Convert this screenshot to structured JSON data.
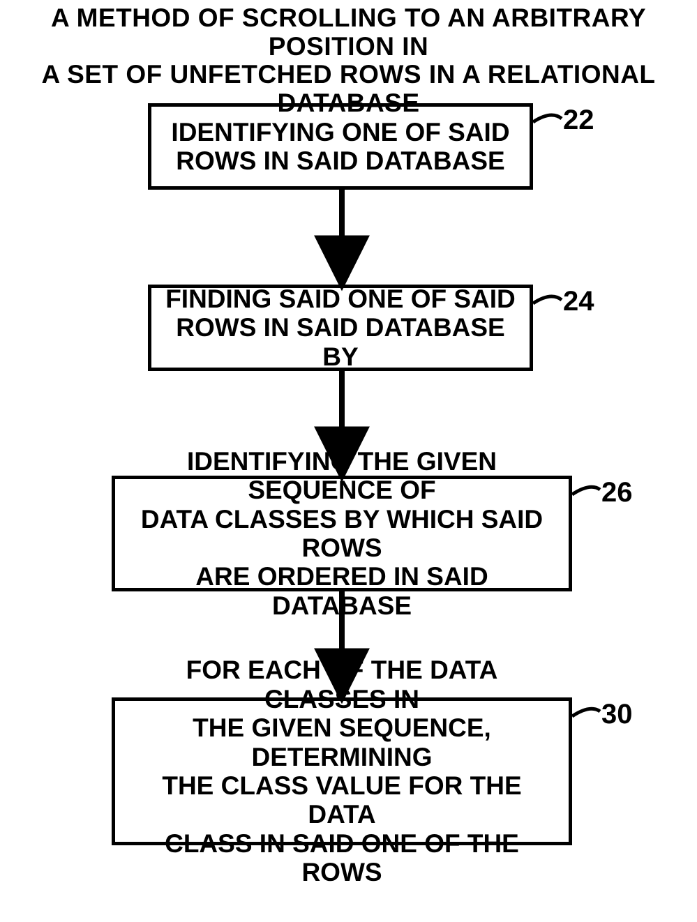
{
  "title": {
    "line1": "A METHOD OF SCROLLING TO AN ARBITRARY POSITION IN",
    "line2": "A SET OF UNFETCHED ROWS IN A RELATIONAL DATABASE"
  },
  "steps": [
    {
      "ref": "22",
      "lines": [
        "IDENTIFYING ONE OF SAID",
        "ROWS IN SAID DATABASE"
      ]
    },
    {
      "ref": "24",
      "lines": [
        "FINDING SAID ONE OF SAID",
        "ROWS IN SAID DATABASE BY"
      ]
    },
    {
      "ref": "26",
      "lines": [
        "IDENTIFYING THE GIVEN SEQUENCE OF",
        "DATA CLASSES BY WHICH SAID ROWS",
        "ARE ORDERED IN SAID DATABASE"
      ]
    },
    {
      "ref": "30",
      "lines": [
        "FOR EACH OF THE DATA CLASSES IN",
        "THE GIVEN SEQUENCE, DETERMINING",
        "THE CLASS VALUE FOR THE DATA",
        "CLASS IN SAID ONE OF THE ROWS"
      ]
    }
  ]
}
